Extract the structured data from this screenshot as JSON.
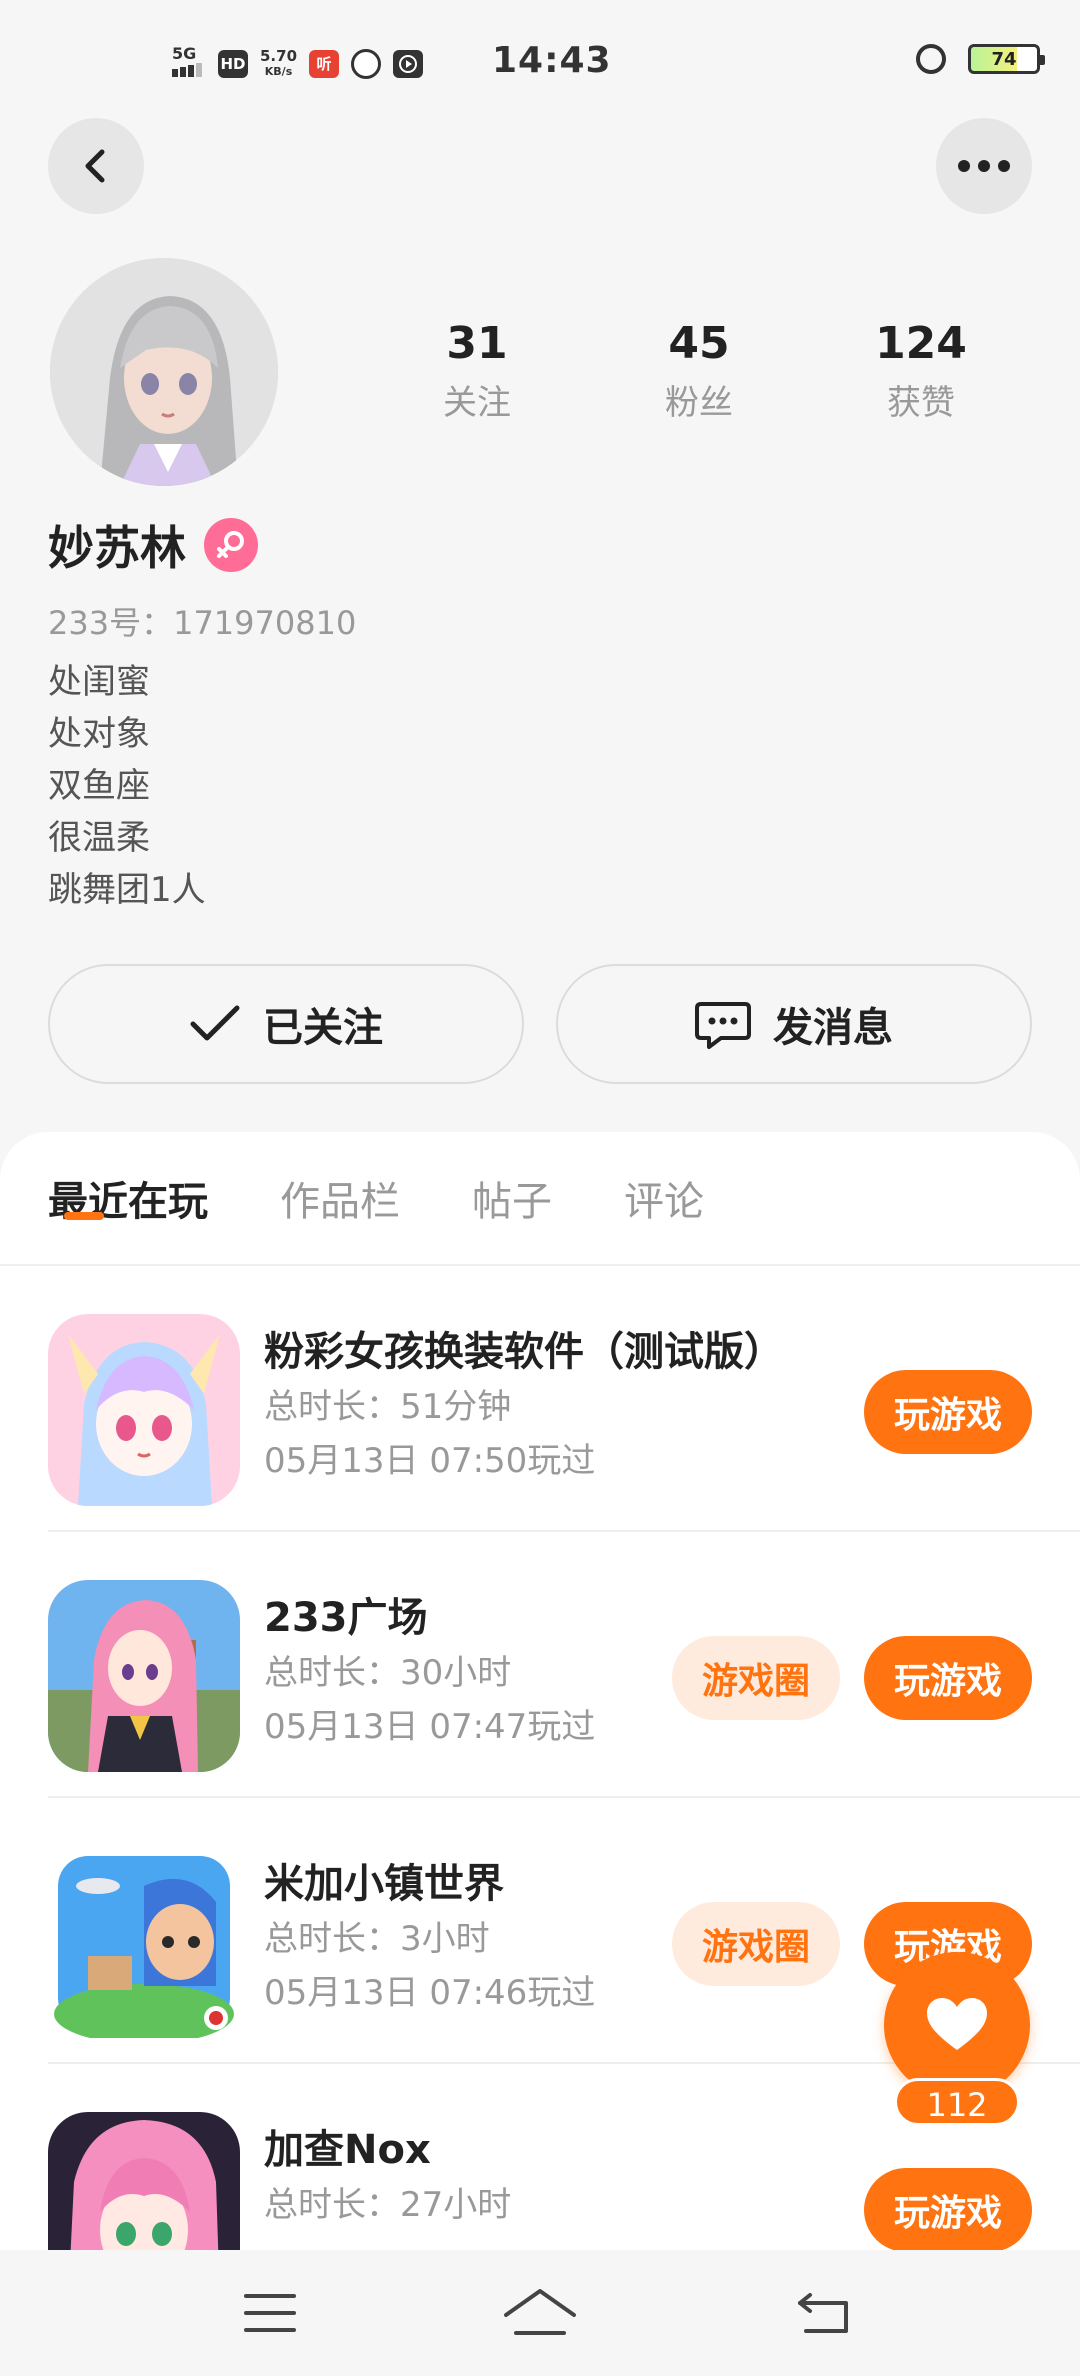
{
  "status_bar": {
    "network": "5G",
    "hd": "HD",
    "speed_value": "5.70",
    "speed_unit": "KB/s",
    "app_badge": "听",
    "time": "14:43",
    "battery": "74"
  },
  "profile": {
    "nickname": "妙苏林",
    "account_id": "233号：171970810",
    "stats": [
      {
        "value": "31",
        "label": "关注"
      },
      {
        "value": "45",
        "label": "粉丝"
      },
      {
        "value": "124",
        "label": "获赞"
      }
    ],
    "bio": [
      "处闺蜜",
      "处对象",
      "双鱼座",
      "很温柔",
      "跳舞团1人"
    ],
    "follow_label": "已关注",
    "message_label": "发消息"
  },
  "tabs": [
    {
      "label": "最近在玩",
      "active": true
    },
    {
      "label": "作品栏",
      "active": false
    },
    {
      "label": "帖子",
      "active": false
    },
    {
      "label": "评论",
      "active": false
    }
  ],
  "games": [
    {
      "title": "粉彩女孩换装软件（测试版）",
      "duration": "总时长：51分钟",
      "last_played": "05月13日 07:50玩过",
      "play_label": "玩游戏",
      "circle_label": ""
    },
    {
      "title": "233广场",
      "duration": "总时长：30小时",
      "last_played": "05月13日 07:47玩过",
      "play_label": "玩游戏",
      "circle_label": "游戏圈"
    },
    {
      "title": "米加小镇世界",
      "duration": "总时长：3小时",
      "last_played": "05月13日 07:46玩过",
      "play_label": "玩游戏",
      "circle_label": "游戏圈"
    },
    {
      "title": "加查Nox",
      "duration": "总时长：27小时",
      "last_played": "",
      "play_label": "玩游戏",
      "circle_label": ""
    }
  ],
  "like": {
    "count": "112"
  },
  "colors": {
    "accent": "#ff7310",
    "accent_light": "#ffebdd",
    "female_badge": "#ff6d97"
  }
}
